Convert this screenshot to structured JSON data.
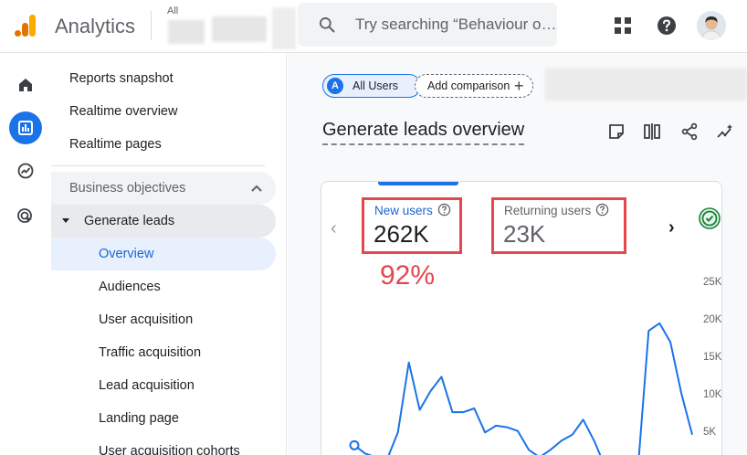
{
  "app": {
    "title": "Analytics",
    "account_label": "All"
  },
  "search": {
    "placeholder": "Try searching “Behaviour o…"
  },
  "rail": {
    "items": [
      "home",
      "reports",
      "explore",
      "advertising"
    ]
  },
  "nav": {
    "top_items": [
      "Reports snapshot",
      "Realtime overview",
      "Realtime pages"
    ],
    "section": "Business objectives",
    "group": "Generate leads",
    "children": [
      "Overview",
      "Audiences",
      "User acquisition",
      "Traffic acquisition",
      "Lead acquisition",
      "Landing page",
      "User acquisition cohorts"
    ],
    "selected": "Overview"
  },
  "main": {
    "chip_users_badge": "A",
    "chip_users": "All Users",
    "chip_compare": "Add comparison",
    "page_title": "Generate leads overview"
  },
  "card": {
    "metrics": [
      {
        "label": "New users",
        "value": "262K"
      },
      {
        "label": "Returning users",
        "value": "23K"
      }
    ],
    "annotation": "92%"
  },
  "chart_data": {
    "type": "line",
    "y_ticks": [
      "25K",
      "20K",
      "15K",
      "10K",
      "5K"
    ],
    "ylim": [
      0,
      25000
    ],
    "series": [
      {
        "values": [
          3600,
          2500,
          2000,
          1700,
          5300,
          14600,
          8300,
          10800,
          12700,
          8000,
          8000,
          8500,
          5300,
          6200,
          6000,
          5500,
          3000,
          2000,
          3000,
          4200,
          5000,
          7000,
          4200,
          800,
          1200,
          400,
          0,
          18800,
          19800,
          17300,
          10500,
          5000
        ]
      }
    ]
  },
  "colors": {
    "accent": "#1a73e8",
    "highlight": "#e5474d",
    "logo_orange": "#f9ab00",
    "logo_dark": "#e37400"
  }
}
